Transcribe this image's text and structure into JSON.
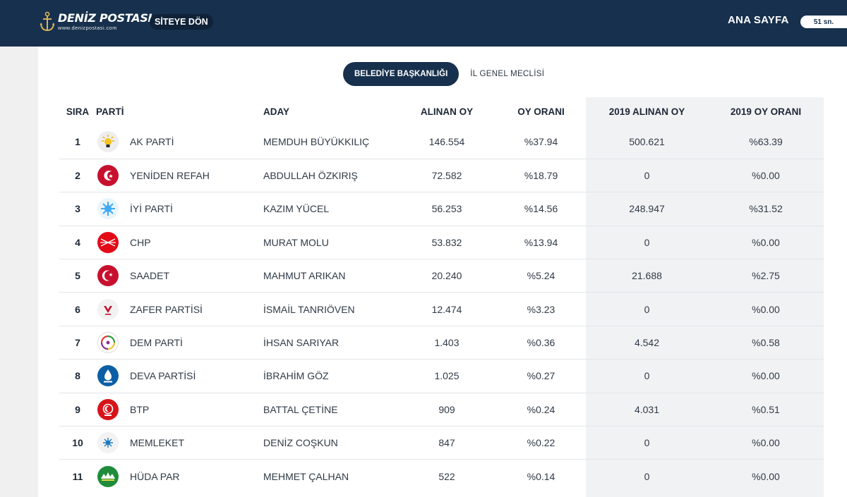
{
  "header": {
    "logo_name": "DENİZ POSTASI",
    "logo_url": "www.denizpostasi.com",
    "back_label": "SİTEYE DÖN",
    "home_label": "ANA SAYFA",
    "countdown": "51 sn."
  },
  "tabs": {
    "active": "BELEDİYE BAŞKANLIĞI",
    "other": "İL GENEL MECLİSİ"
  },
  "table": {
    "headers": {
      "sira": "SIRA",
      "parti": "PARTİ",
      "aday": "ADAY",
      "alinan_oy": "ALINAN OY",
      "oy_orani": "OY ORANI",
      "oy_2019": "2019 ALINAN OY",
      "oran_2019": "2019 OY ORANI"
    },
    "rows": [
      {
        "sira": "1",
        "parti": "AK PARTİ",
        "aday": "MEMDUH BÜYÜKKILIÇ",
        "oy": "146.554",
        "oran": "%37.94",
        "oy2019": "500.621",
        "oran2019": "%63.39",
        "logo_icon": "ak-parti-logo-icon"
      },
      {
        "sira": "2",
        "parti": "YENİDEN REFAH",
        "aday": "ABDULLAH ÖZKIRIŞ",
        "oy": "72.582",
        "oran": "%18.79",
        "oy2019": "0",
        "oran2019": "%0.00",
        "logo_icon": "yeniden-refah-logo-icon"
      },
      {
        "sira": "3",
        "parti": "İYİ PARTİ",
        "aday": "KAZIM YÜCEL",
        "oy": "56.253",
        "oran": "%14.56",
        "oy2019": "248.947",
        "oran2019": "%31.52",
        "logo_icon": "iyi-parti-logo-icon"
      },
      {
        "sira": "4",
        "parti": "CHP",
        "aday": "MURAT MOLU",
        "oy": "53.832",
        "oran": "%13.94",
        "oy2019": "0",
        "oran2019": "%0.00",
        "logo_icon": "chp-logo-icon"
      },
      {
        "sira": "5",
        "parti": "SAADET",
        "aday": "MAHMUT ARIKAN",
        "oy": "20.240",
        "oran": "%5.24",
        "oy2019": "21.688",
        "oran2019": "%2.75",
        "logo_icon": "saadet-logo-icon"
      },
      {
        "sira": "6",
        "parti": "ZAFER PARTİSİ",
        "aday": "İSMAİL TANRIÖVEN",
        "oy": "12.474",
        "oran": "%3.23",
        "oy2019": "0",
        "oran2019": "%0.00",
        "logo_icon": "zafer-logo-icon"
      },
      {
        "sira": "7",
        "parti": "DEM PARTİ",
        "aday": "İHSAN SARIYAR",
        "oy": "1.403",
        "oran": "%0.36",
        "oy2019": "4.542",
        "oran2019": "%0.58",
        "logo_icon": "dem-logo-icon"
      },
      {
        "sira": "8",
        "parti": "DEVA PARTİSİ",
        "aday": "İBRAHİM GÖZ",
        "oy": "1.025",
        "oran": "%0.27",
        "oy2019": "0",
        "oran2019": "%0.00",
        "logo_icon": "deva-logo-icon"
      },
      {
        "sira": "9",
        "parti": "BTP",
        "aday": "BATTAL ÇETİNE",
        "oy": "909",
        "oran": "%0.24",
        "oy2019": "4.031",
        "oran2019": "%0.51",
        "logo_icon": "btp-logo-icon"
      },
      {
        "sira": "10",
        "parti": "MEMLEKET",
        "aday": "DENİZ COŞKUN",
        "oy": "847",
        "oran": "%0.22",
        "oy2019": "0",
        "oran2019": "%0.00",
        "logo_icon": "memleket-logo-icon"
      },
      {
        "sira": "11",
        "parti": "HÜDA PAR",
        "aday": "MEHMET ÇALHAN",
        "oy": "522",
        "oran": "%0.14",
        "oy2019": "0",
        "oran2019": "%0.00",
        "logo_icon": "huda-par-logo-icon"
      }
    ]
  },
  "colors": {
    "header_bg": "#16304d",
    "history_bg": "#f1f2f4"
  }
}
